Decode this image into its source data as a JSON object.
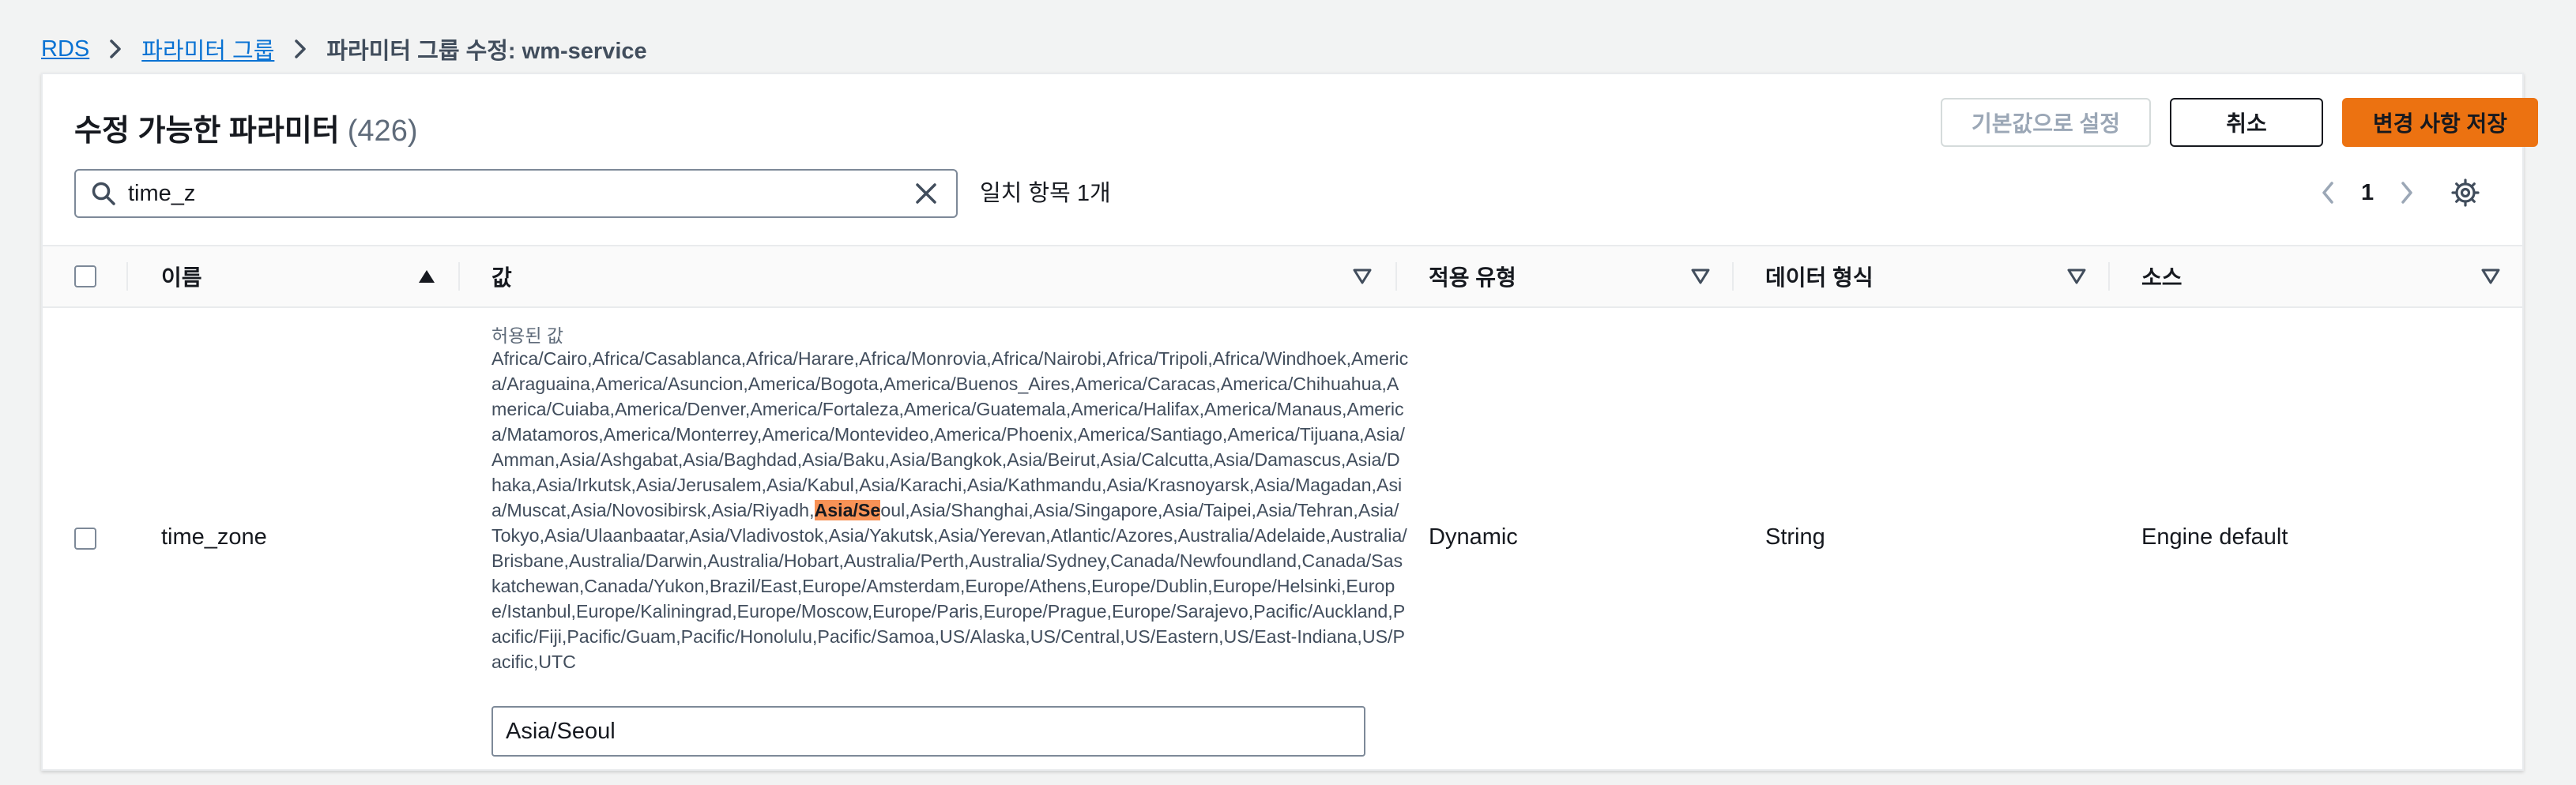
{
  "breadcrumb": {
    "root": "RDS",
    "parent": "파라미터 그룹",
    "current": "파라미터 그룹 수정: wm-service"
  },
  "panel": {
    "title": "수정 가능한 파라미터",
    "count": "(426)",
    "buttons": {
      "reset_defaults": "기본값으로 설정",
      "cancel": "취소",
      "save": "변경 사항 저장"
    }
  },
  "search": {
    "value": "time_z",
    "match_text": "일치 항목 1개"
  },
  "pagination": {
    "current_page": "1"
  },
  "table": {
    "columns": [
      "이름",
      "값",
      "적용 유형",
      "데이터 형식",
      "소스"
    ],
    "sorted_column": "이름",
    "rows": [
      {
        "name": "time_zone",
        "allowed_label": "허용된 값",
        "allowed_before": "Africa/Cairo,Africa/Casablanca,Africa/Harare,Africa/Monrovia,Africa/Nairobi,Africa/Tripoli,Africa/Windhoek,America/Araguaina,America/Asuncion,America/Bogota,America/Buenos_Aires,America/Caracas,America/Chihuahua,America/Cuiaba,America/Denver,America/Fortaleza,America/Guatemala,America/Halifax,America/Manaus,America/Matamoros,America/Monterrey,America/Montevideo,America/Phoenix,America/Santiago,America/Tijuana,Asia/Amman,Asia/Ashgabat,Asia/Baghdad,Asia/Baku,Asia/Bangkok,Asia/Beirut,Asia/Calcutta,Asia/Damascus,Asia/Dhaka,Asia/Irkutsk,Asia/Jerusalem,Asia/Kabul,Asia/Karachi,Asia/Kathmandu,Asia/Krasnoyarsk,Asia/Magadan,Asia/Muscat,Asia/Novosibirsk,Asia/Riyadh,",
        "allowed_highlight": "Asia/Se",
        "allowed_after": "oul,Asia/Shanghai,Asia/Singapore,Asia/Taipei,Asia/Tehran,Asia/Tokyo,Asia/Ulaanbaatar,Asia/Vladivostok,Asia/Yakutsk,Asia/Yerevan,Atlantic/Azores,Australia/Adelaide,Australia/Brisbane,Australia/Darwin,Australia/Hobart,Australia/Perth,Australia/Sydney,Canada/Newfoundland,Canada/Saskatchewan,Canada/Yukon,Brazil/East,Europe/Amsterdam,Europe/Athens,Europe/Dublin,Europe/Helsinki,Europe/Istanbul,Europe/Kaliningrad,Europe/Moscow,Europe/Paris,Europe/Prague,Europe/Sarajevo,Pacific/Auckland,Pacific/Fiji,Pacific/Guam,Pacific/Honolulu,Pacific/Samoa,US/Alaska,US/Central,US/Eastern,US/East-Indiana,US/Pacific,UTC",
        "value": "Asia/Seoul",
        "apply_type": "Dynamic",
        "data_type": "String",
        "source": "Engine default"
      }
    ]
  },
  "colors": {
    "link": "#0972d3",
    "primary_button": "#ec7211",
    "highlight": "#f89256",
    "background": "#f2f3f3"
  },
  "icons": [
    "chevron-right-icon",
    "search-icon",
    "close-icon",
    "chevron-left-icon",
    "settings-gear-icon",
    "sort-ascending-icon",
    "sort-descending-icon"
  ]
}
